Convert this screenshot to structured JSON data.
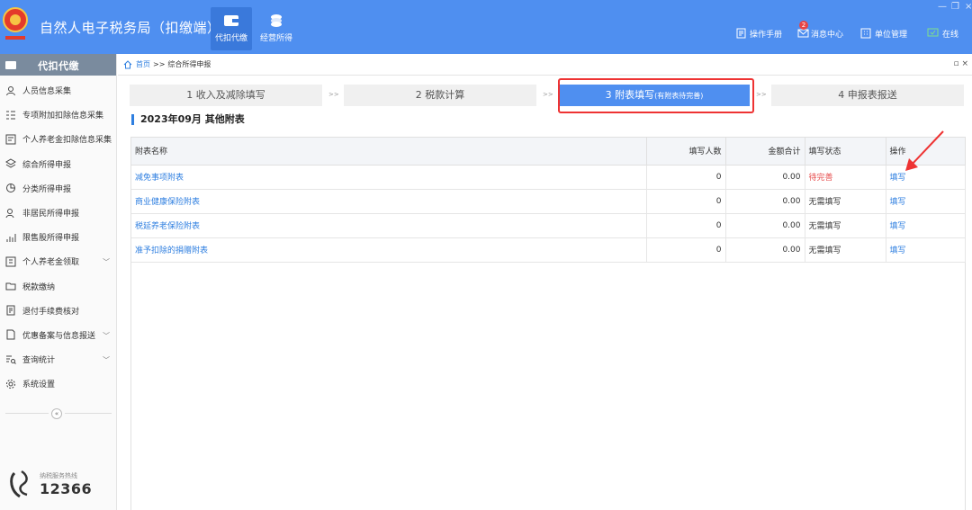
{
  "app": {
    "title": "自然人电子税务局（扣缴端）"
  },
  "header": {
    "tabs": [
      {
        "label": "代扣代缴",
        "icon": "wallet-icon"
      },
      {
        "label": "经营所得",
        "icon": "coins-icon"
      }
    ],
    "actions": [
      {
        "label": "操作手册",
        "icon": "manual-icon"
      },
      {
        "label": "消息中心",
        "icon": "message-icon",
        "badge": "2"
      },
      {
        "label": "单位管理",
        "icon": "building-icon"
      },
      {
        "label": "在线",
        "icon": "online-icon"
      }
    ]
  },
  "sidebar": {
    "title": "代扣代缴",
    "items": [
      {
        "label": "人员信息采集",
        "icon": "user-icon"
      },
      {
        "label": "专项附加扣除信息采集",
        "icon": "list-icon"
      },
      {
        "label": "个人养老金扣除信息采集",
        "icon": "form-icon"
      },
      {
        "label": "综合所得申报",
        "icon": "layers-icon"
      },
      {
        "label": "分类所得申报",
        "icon": "pie-icon"
      },
      {
        "label": "非居民所得申报",
        "icon": "person-icon"
      },
      {
        "label": "限售股所得申报",
        "icon": "chart-icon"
      },
      {
        "label": "个人养老金领取",
        "icon": "pension-icon",
        "expandable": true
      },
      {
        "label": "税款缴纳",
        "icon": "folder-icon"
      },
      {
        "label": "退付手续费核对",
        "icon": "receipt-icon"
      },
      {
        "label": "优惠备案与信息报送",
        "icon": "document-icon",
        "expandable": true
      },
      {
        "label": "查询统计",
        "icon": "search-list-icon",
        "expandable": true
      },
      {
        "label": "系统设置",
        "icon": "gear-icon"
      }
    ],
    "collapse": "«",
    "hotline": {
      "label": "纳税服务热线",
      "number": "12366"
    }
  },
  "breadcrumb": {
    "home": "首页",
    "separator": ">>",
    "current": "综合所得申报"
  },
  "steps": [
    {
      "label": "1 收入及减除填写"
    },
    {
      "label": "2 税款计算"
    },
    {
      "label": "3 附表填写",
      "sub": "(有附表待完善)"
    },
    {
      "label": "4 申报表报送"
    }
  ],
  "step_separator": ">>",
  "section_title": "2023年09月 其他附表",
  "table": {
    "columns": [
      "附表名称",
      "填写人数",
      "金额合计",
      "填写状态",
      "操作"
    ],
    "rows": [
      {
        "name": "减免事项附表",
        "count": "0",
        "amount": "0.00",
        "status": "待完善",
        "action": "填写"
      },
      {
        "name": "商业健康保险附表",
        "count": "0",
        "amount": "0.00",
        "status": "无需填写",
        "action": "填写"
      },
      {
        "name": "税延养老保险附表",
        "count": "0",
        "amount": "0.00",
        "status": "无需填写",
        "action": "填写"
      },
      {
        "name": "准予扣除的捐赠附表",
        "count": "0",
        "amount": "0.00",
        "status": "无需填写",
        "action": "填写"
      }
    ]
  },
  "colors": {
    "header_bg": "#4f8ff0",
    "accent": "#2f7fe0",
    "warning": "#e64a4a",
    "highlight_box": "#e33333"
  }
}
